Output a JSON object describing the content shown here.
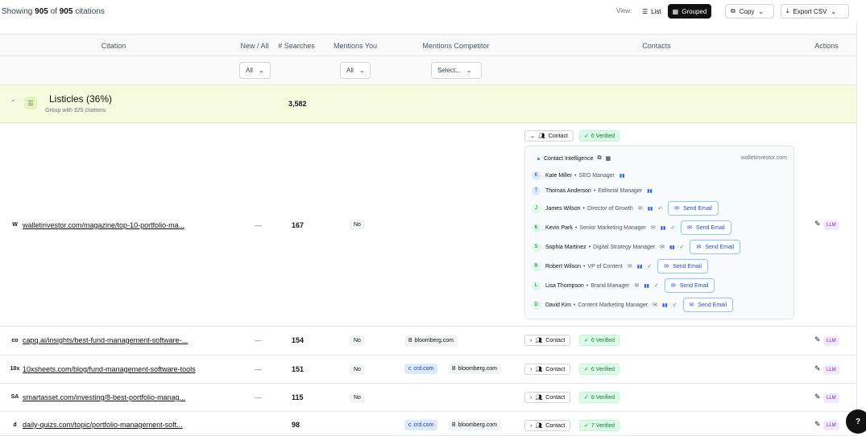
{
  "summary": {
    "prefix": "Showing",
    "shown": "905",
    "of": "of",
    "total": "905",
    "suffix": "citations"
  },
  "toolbar": {
    "view_label": "View:",
    "list_label": "List",
    "grouped_label": "Grouped",
    "copy_label": "Copy",
    "export_label": "Export CSV"
  },
  "columns": [
    "Citation",
    "New / All",
    "# Searches",
    "Mentions You",
    "Mentions Competitor",
    "Contacts",
    "Actions"
  ],
  "filters": {
    "new_all": "All",
    "mentions_you": "All",
    "competitor_placeholder": "Select..."
  },
  "group": {
    "title": "Listicles (36%)",
    "subtitle": "Group with 325 citations",
    "searches": "3,582"
  },
  "panel": {
    "title": "Contact Intelligence",
    "domain": "walletinvestor.com"
  },
  "contacts": [
    {
      "initial": "K",
      "name": "Kate Miller",
      "role": "SEO Manager",
      "email": false,
      "verified": false
    },
    {
      "initial": "T",
      "name": "Thomas Anderson",
      "role": "Editorial Manager",
      "email": false,
      "verified": false
    },
    {
      "initial": "J",
      "name": "James Wilson",
      "role": "Director of Growth",
      "email": true,
      "verified": true
    },
    {
      "initial": "K",
      "name": "Kevin Park",
      "role": "Senior Marketing Manager",
      "email": true,
      "verified": true
    },
    {
      "initial": "S",
      "name": "Sophia Martinez",
      "role": "Digital Strategy Manager",
      "email": true,
      "verified": true
    },
    {
      "initial": "R",
      "name": "Robert Wilson",
      "role": "VP of Content",
      "email": true,
      "verified": true
    },
    {
      "initial": "L",
      "name": "Lisa Thompson",
      "role": "Brand Manager",
      "email": true,
      "verified": true
    },
    {
      "initial": "D",
      "name": "David Kim",
      "role": "Content Marketing Manager",
      "email": true,
      "verified": true
    }
  ],
  "labels": {
    "send_email": "Send Email",
    "contact": "Contact",
    "no": "No",
    "dash": "—",
    "llm": "LLM"
  },
  "rows": [
    {
      "favicon": "W",
      "url": "walletinvestor.com/magazine/top-10-portfolio-ma...",
      "searches": "167",
      "competitors": [],
      "verified": "6 Verified"
    },
    {
      "favicon": "co",
      "url": "capq.ai/insights/best-fund-management-software-...",
      "searches": "154",
      "competitors": [
        {
          "name": "bloomberg.com",
          "style": "gray",
          "icon": "B"
        }
      ],
      "verified": "6 Verified"
    },
    {
      "favicon": "10x",
      "url": "10xsheets.com/blog/fund-management-software-tools",
      "searches": "151",
      "competitors": [
        {
          "name": "crd.com",
          "style": "blue",
          "icon": "c"
        },
        {
          "name": "bloomberg.com",
          "style": "gray",
          "icon": "B"
        }
      ],
      "verified": "6 Verified"
    },
    {
      "favicon": "SA",
      "url": "smartasset.com/investing/8-best-portfolio-manag...",
      "searches": "115",
      "competitors": [],
      "verified": "8 Verified"
    },
    {
      "favicon": "d",
      "url": "daily-quizs.com/topic/portfolio-management-soft...",
      "searches": "98",
      "competitors": [
        {
          "name": "crd.com",
          "style": "blue",
          "icon": "c"
        },
        {
          "name": "bloomberg.com",
          "style": "gray",
          "icon": "B"
        }
      ],
      "verified": "7 Verified"
    }
  ]
}
